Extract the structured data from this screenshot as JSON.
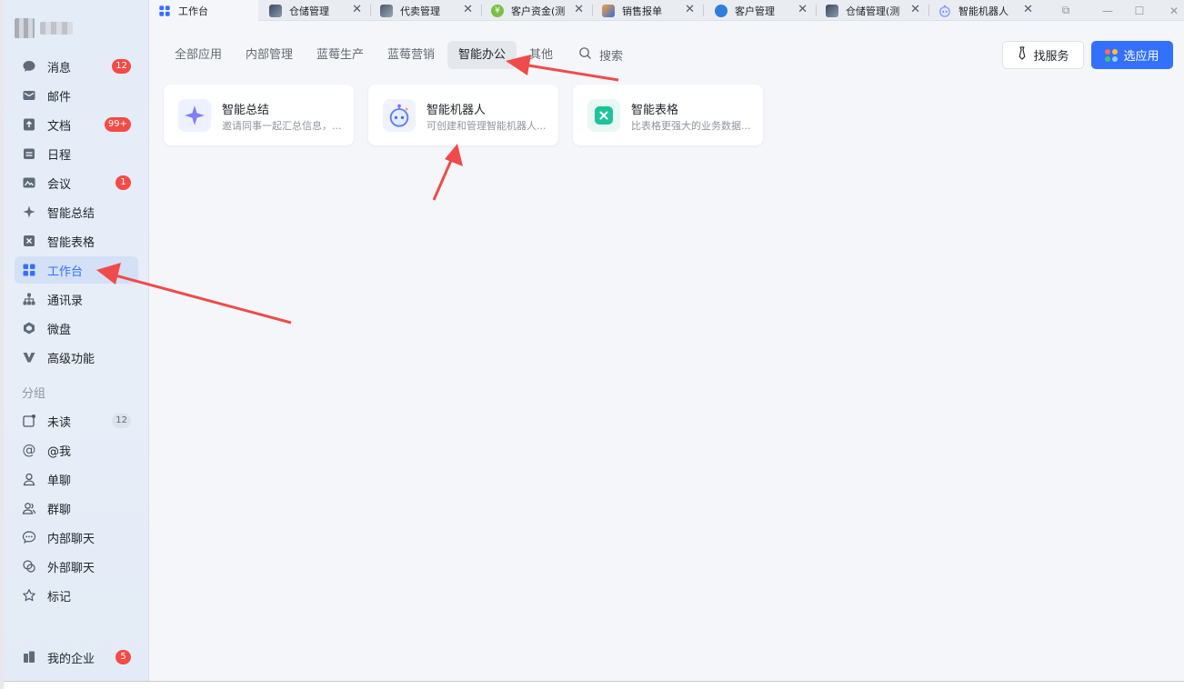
{
  "tabs": [
    {
      "label": "工作台",
      "active": true
    },
    {
      "label": "仓储管理"
    },
    {
      "label": "代卖管理"
    },
    {
      "label": "客户资金(测"
    },
    {
      "label": "销售报单"
    },
    {
      "label": "客户管理"
    },
    {
      "label": "仓储管理(测"
    },
    {
      "label": "智能机器人"
    }
  ],
  "sidebar": {
    "items": [
      {
        "label": "消息",
        "icon": "chat-bubble-icon",
        "badge": "12"
      },
      {
        "label": "邮件",
        "icon": "mail-icon"
      },
      {
        "label": "文档",
        "icon": "document-icon",
        "badge": "99+"
      },
      {
        "label": "日程",
        "icon": "calendar-icon"
      },
      {
        "label": "会议",
        "icon": "meeting-icon",
        "badge": "1"
      },
      {
        "label": "智能总结",
        "icon": "sparkle-icon"
      },
      {
        "label": "智能表格",
        "icon": "smart-table-icon"
      },
      {
        "label": "工作台",
        "icon": "grid-apps-icon"
      },
      {
        "label": "通讯录",
        "icon": "org-chart-icon"
      },
      {
        "label": "微盘",
        "icon": "cloud-drive-icon"
      },
      {
        "label": "高级功能",
        "icon": "v-icon"
      }
    ],
    "group_title": "分组",
    "groups": [
      {
        "label": "未读",
        "icon": "unread-icon",
        "badge": "12"
      },
      {
        "label": "@我",
        "icon": "at-icon"
      },
      {
        "label": "单聊",
        "icon": "person-icon"
      },
      {
        "label": "群聊",
        "icon": "group-icon"
      },
      {
        "label": "内部聊天",
        "icon": "chat-dots-icon"
      },
      {
        "label": "外部聊天",
        "icon": "external-chat-icon"
      },
      {
        "label": "标记",
        "icon": "star-icon"
      }
    ],
    "enterprise": {
      "label": "我的企业",
      "icon": "building-icon",
      "badge": "5"
    }
  },
  "categories": [
    {
      "label": "全部应用"
    },
    {
      "label": "内部管理"
    },
    {
      "label": "蓝莓生产"
    },
    {
      "label": "蓝莓营销"
    },
    {
      "label": "智能办公",
      "active": true
    },
    {
      "label": "其他"
    }
  ],
  "search_label": "搜索",
  "buttons": {
    "find_service": "找服务",
    "choose_app": "选应用"
  },
  "apps": [
    {
      "title": "智能总结",
      "desc": "邀请同事一起汇总信息，...",
      "icon": "sparkle-icon"
    },
    {
      "title": "智能机器人",
      "desc": "可创建和管理智能机器人...",
      "icon": "robot-icon"
    },
    {
      "title": "智能表格",
      "desc": "比表格更强大的业务数据...",
      "icon": "smart-table-icon"
    }
  ],
  "colors": {
    "accent": "#3370ff",
    "badge": "#f54a45",
    "annotation_arrow": "#ef4b4b"
  }
}
